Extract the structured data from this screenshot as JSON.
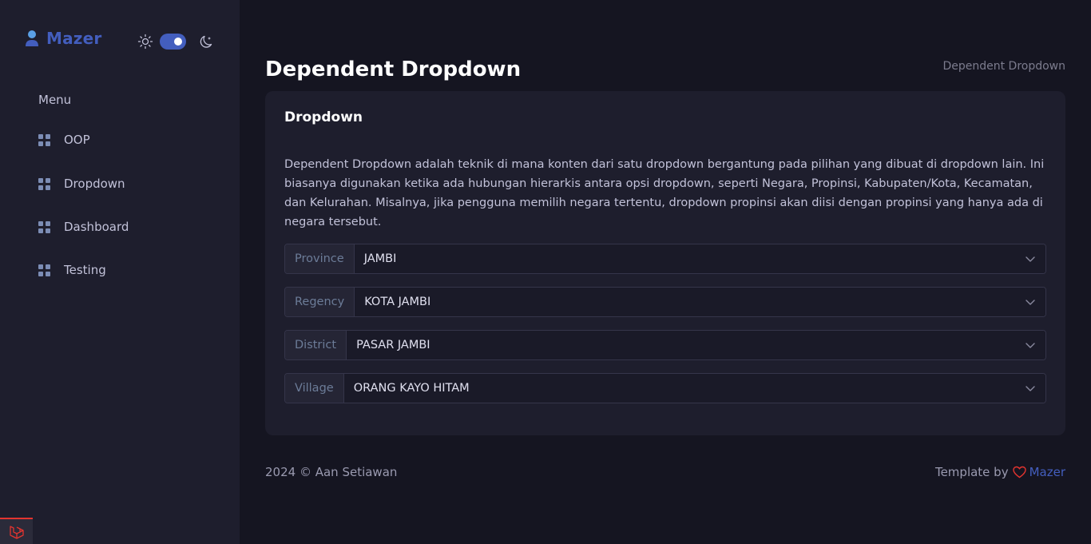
{
  "brand": {
    "name": "Mazer"
  },
  "sidebar": {
    "menu_title": "Menu",
    "items": [
      {
        "label": "OOP"
      },
      {
        "label": "Dropdown"
      },
      {
        "label": "Dashboard"
      },
      {
        "label": "Testing"
      }
    ]
  },
  "page": {
    "title": "Dependent Dropdown",
    "breadcrumb": "Dependent Dropdown"
  },
  "card": {
    "title": "Dropdown",
    "description": "Dependent Dropdown adalah teknik di mana konten dari satu dropdown bergantung pada pilihan yang dibuat di dropdown lain. Ini biasanya digunakan ketika ada hubungan hierarkis antara opsi dropdown, seperti Negara, Propinsi, Kabupaten/Kota, Kecamatan, dan Kelurahan. Misalnya, jika pengguna memilih negara tertentu, dropdown propinsi akan diisi dengan propinsi yang hanya ada di negara tersebut.",
    "fields": [
      {
        "label": "Province",
        "value": "JAMBI"
      },
      {
        "label": "Regency",
        "value": "KOTA JAMBI"
      },
      {
        "label": "District",
        "value": "PASAR JAMBI"
      },
      {
        "label": "Village",
        "value": "ORANG KAYO HITAM"
      }
    ]
  },
  "footer": {
    "copyright": "2024 © Aan Setiawan",
    "template_by": "Template by",
    "template_link": "Mazer"
  },
  "colors": {
    "accent": "#435ebe",
    "background": "#151521",
    "surface": "#1e1e2d",
    "heart": "#e3342f"
  }
}
